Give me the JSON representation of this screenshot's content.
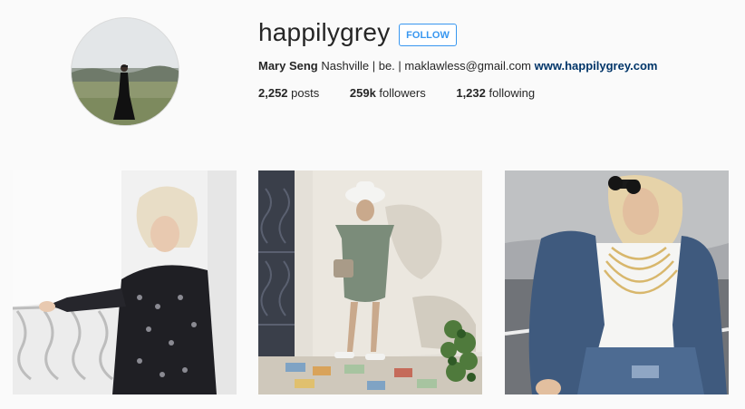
{
  "profile": {
    "username": "happilygrey",
    "follow_label": "FOLLOW",
    "full_name": "Mary Seng",
    "bio_text": "Nashville | be. | maklawless@gmail.com",
    "website": "www.happilygrey.com"
  },
  "stats": [
    {
      "value": "2,252",
      "label": "posts"
    },
    {
      "value": "259k",
      "label": "followers"
    },
    {
      "value": "1,232",
      "label": "following"
    }
  ],
  "colors": {
    "accent": "#3897f0",
    "link": "#003569",
    "background": "#fafafa"
  },
  "icons": {
    "avatar": "profile-photo"
  }
}
